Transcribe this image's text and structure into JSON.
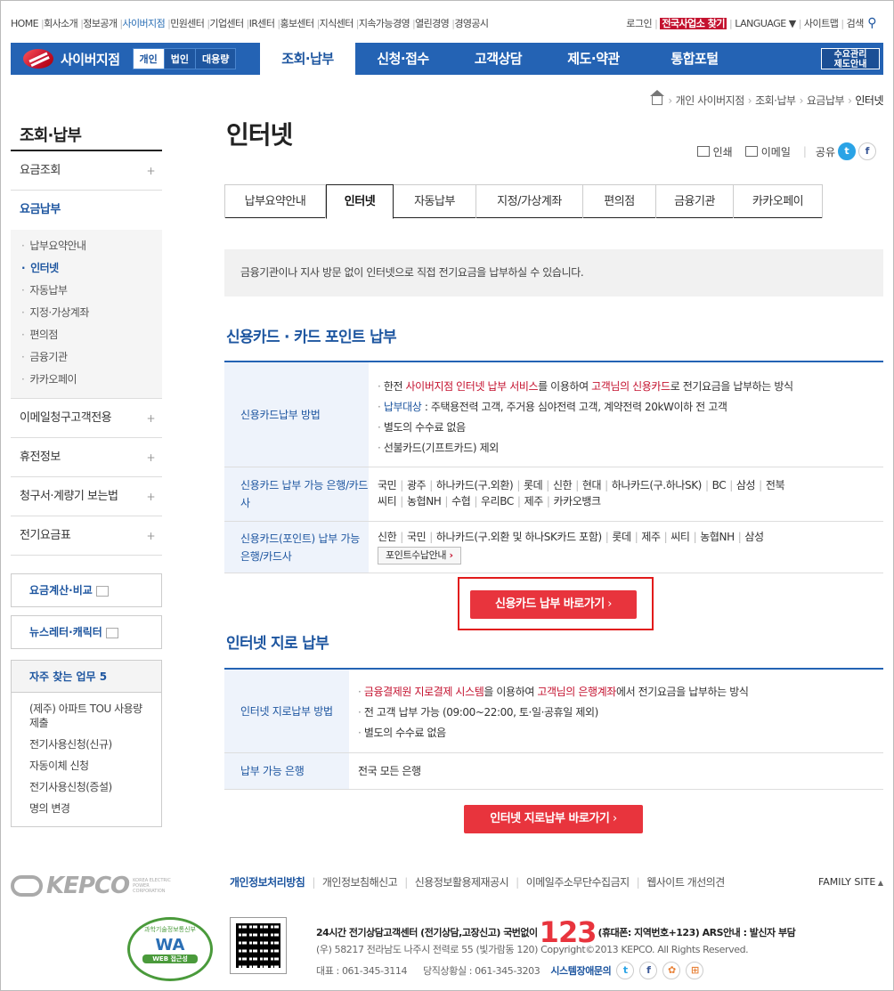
{
  "util": {
    "left": [
      "HOME",
      "회사소개",
      "정보공개",
      "사이버지점",
      "민원센터",
      "기업센터",
      "IR센터",
      "홍보센터",
      "지식센터",
      "지속가능경영",
      "열린경영",
      "경영공시"
    ],
    "right": {
      "login": "로그인",
      "find_office": "전국사업소 찾기",
      "language": "LANGUAGE",
      "sitemap": "사이트맵",
      "search": "검색"
    }
  },
  "nav": {
    "brand": "사이버지점",
    "segments": [
      "개인",
      "법인",
      "대용량"
    ],
    "menu": [
      "조회·납부",
      "신청·접수",
      "고객상담",
      "제도·약관",
      "통합포털"
    ],
    "demand_line1": "수요관리",
    "demand_line2": "제도안내"
  },
  "breadcrumb": [
    "개인 사이버지점",
    "조회·납부",
    "요금납부",
    "인터넷"
  ],
  "sidebar": {
    "title": "조회·납부",
    "items_top": [
      {
        "label": "요금조회",
        "plus": "+"
      },
      {
        "label": "요금납부",
        "plus": ""
      }
    ],
    "sub": [
      "납부요약안내",
      "인터넷",
      "자동납부",
      "지정·가상계좌",
      "편의점",
      "금융기관",
      "카카오페이"
    ],
    "items_bottom": [
      {
        "label": "이메일청구고객전용",
        "plus": "+"
      },
      {
        "label": "휴전정보",
        "plus": "+"
      },
      {
        "label": "청구서·계량기 보는법",
        "plus": "+"
      },
      {
        "label": "전기요금표",
        "plus": "+"
      }
    ],
    "box1": "요금계산·비교",
    "box2": "뉴스레터·캐릭터",
    "fav_title": "자주 찾는 업무 5",
    "fav": [
      "(제주) 아파트 TOU 사용량 제출",
      "전기사용신청(신규)",
      "자동이체 신청",
      "전기사용신청(증설)",
      "명의 변경"
    ]
  },
  "page": {
    "title": "인터넷",
    "tools": {
      "print": "인쇄",
      "email": "이메일",
      "share": "공유",
      "twitter": "t",
      "facebook": "f"
    },
    "tabs": [
      "납부요약안내",
      "인터넷",
      "자동납부",
      "지정/가상계좌",
      "편의점",
      "금융기관",
      "카카오페이"
    ],
    "notice": "금융기관이나 지사 방문 없이 인터넷으로 직접 전기요금을 납부하실 수 있습니다.",
    "card_section": {
      "heading": "신용카드 · 카드 포인트 납부",
      "method_th": "신용카드납부 방법",
      "method": {
        "l1a": "한전 ",
        "l1b": "사이버지점 인터넷 납부 서비스",
        "l1c": "를 이용하여 ",
        "l1d": "고객님의 신용카드",
        "l1e": "로 전기요금을 납부하는 방식",
        "l2a": "납부대상",
        "l2b": " : 주택용전력 고객, 주거용 심야전력 고객, 계약전력 20kW이하 전 고객",
        "l3": "별도의 수수료 없음",
        "l4": "선불카드(기프트카드) 제외"
      },
      "cards_th": "신용카드 납부 가능 은행/카드사",
      "cards": [
        "국민",
        "광주",
        "하나카드(구.외환)",
        "롯데",
        "신한",
        "현대",
        "하나카드(구.하나SK)",
        "BC",
        "삼성",
        "전북",
        "씨티",
        "농협NH",
        "수협",
        "우리BC",
        "제주",
        "카카오뱅크"
      ],
      "points_th": "신용카드(포인트) 납부 가능 은행/카드사",
      "points": [
        "신한",
        "국민",
        "하나카드(구.외환 및 하나SK카드 포함)",
        "롯데",
        "제주",
        "씨티",
        "농협NH",
        "삼성"
      ],
      "points_btn": "포인트수납안내",
      "go_btn": "신용카드 납부 바로가기"
    },
    "giro_section": {
      "heading": "인터넷 지로 납부",
      "method_th": "인터넷 지로납부 방법",
      "l1a": "금융결제원 지로결제 시스템",
      "l1b": "을 이용하여 ",
      "l1c": "고객님의 은행계좌",
      "l1d": "에서 전기요금을 납부하는 방식",
      "l2": "전 고객 납부 가능 (09:00~22:00, 토·일·공휴일 제외)",
      "l3": "별도의 수수료 없음",
      "banks_th": "납부 가능 은행",
      "banks": "전국 모든 은행",
      "go_btn": "인터넷 지로납부 바로가기"
    }
  },
  "footer": {
    "kepco": "KEPCO",
    "kepco_sub": "KOREA ELECTRIC POWER CORPORATION",
    "links": [
      "개인정보처리방침",
      "개인정보침해신고",
      "신용정보활용제재공시",
      "이메일주소무단수집금지",
      "웹사이트 개선의견"
    ],
    "family": "FAMILY SITE",
    "wa_top": "과학기술정보통신부",
    "wa": "WA",
    "wa_bottom": "WEB 접근성",
    "cs_a": "24시간 전기상담고객센터 (전기상담,고장신고) 국번없이",
    "cs_num": "123",
    "cs_b": "(휴대폰: 지역번호+123) ARS안내 : 발신자 부담",
    "addr": "(우) 58217 전라남도 나주시 전력로 55 (빛가람동 120)     Copyright©2013 KEPCO. All Rights Reserved.",
    "tel": "대표 : 061-345-3114",
    "tel2": "당직상황실 : 061-345-3203",
    "err": "시스템장애문의",
    "sns": [
      "t",
      "f",
      "✿",
      "⊞"
    ]
  },
  "colors": {
    "primary": "#2463b4",
    "accent": "#e8343d",
    "red": "#c4122f"
  }
}
